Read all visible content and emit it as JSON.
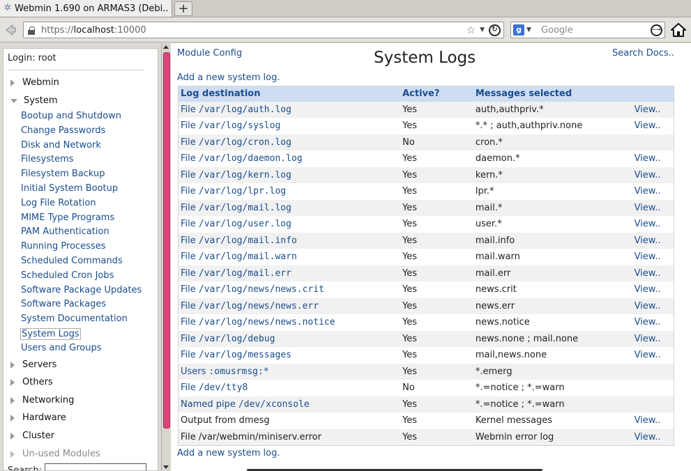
{
  "browser": {
    "tab_title": "Webmin 1.690 on ARMAS3 (Debi...",
    "new_tab_label": "+",
    "url_scheme": "https://",
    "url_host": "localhost",
    "url_port": ":10000",
    "search_engine_letter": "g",
    "search_placeholder": "Google"
  },
  "sidebar": {
    "login": "Login: root",
    "categories_top": [
      {
        "label": "Webmin"
      },
      {
        "label": "System"
      }
    ],
    "modules": [
      "Bootup and Shutdown",
      "Change Passwords",
      "Disk and Network",
      "Filesystems",
      "Filesystem Backup",
      "Initial System Bootup",
      "Log File Rotation",
      "MIME Type Programs",
      "PAM Authentication",
      "Running Processes",
      "Scheduled Commands",
      "Scheduled Cron Jobs",
      "Software Package Updates",
      "Software Packages",
      "System Documentation",
      "System Logs",
      "Users and Groups"
    ],
    "active_module": "System Logs",
    "categories_bottom": [
      "Servers",
      "Others",
      "Networking",
      "Hardware",
      "Cluster",
      "Un-used Modules"
    ],
    "search_label": "Search:"
  },
  "main": {
    "module_config": "Module Config",
    "title": "System Logs",
    "search_docs": "Search Docs..",
    "add_link": "Add a new system log.",
    "columns": [
      "Log destination",
      "Active?",
      "Messages selected",
      ""
    ],
    "rows": [
      {
        "prefix": "File ",
        "path": "/var/log/auth.log",
        "active": "Yes",
        "messages": "auth,authpriv.*",
        "view": "View.."
      },
      {
        "prefix": "File ",
        "path": "/var/log/syslog",
        "active": "Yes",
        "messages": "*.* ; auth,authpriv.none",
        "view": "View.."
      },
      {
        "prefix": "File ",
        "path": "/var/log/cron.log",
        "active": "No",
        "messages": "cron.*",
        "view": ""
      },
      {
        "prefix": "File ",
        "path": "/var/log/daemon.log",
        "active": "Yes",
        "messages": "daemon.*",
        "view": "View.."
      },
      {
        "prefix": "File ",
        "path": "/var/log/kern.log",
        "active": "Yes",
        "messages": "kern.*",
        "view": "View.."
      },
      {
        "prefix": "File ",
        "path": "/var/log/lpr.log",
        "active": "Yes",
        "messages": "lpr.*",
        "view": "View.."
      },
      {
        "prefix": "File ",
        "path": "/var/log/mail.log",
        "active": "Yes",
        "messages": "mail.*",
        "view": "View.."
      },
      {
        "prefix": "File ",
        "path": "/var/log/user.log",
        "active": "Yes",
        "messages": "user.*",
        "view": "View.."
      },
      {
        "prefix": "File ",
        "path": "/var/log/mail.info",
        "active": "Yes",
        "messages": "mail.info",
        "view": "View.."
      },
      {
        "prefix": "File ",
        "path": "/var/log/mail.warn",
        "active": "Yes",
        "messages": "mail.warn",
        "view": "View.."
      },
      {
        "prefix": "File ",
        "path": "/var/log/mail.err",
        "active": "Yes",
        "messages": "mail.err",
        "view": "View.."
      },
      {
        "prefix": "File ",
        "path": "/var/log/news/news.crit",
        "active": "Yes",
        "messages": "news.crit",
        "view": "View.."
      },
      {
        "prefix": "File ",
        "path": "/var/log/news/news.err",
        "active": "Yes",
        "messages": "news.err",
        "view": "View.."
      },
      {
        "prefix": "File ",
        "path": "/var/log/news/news.notice",
        "active": "Yes",
        "messages": "news.notice",
        "view": "View.."
      },
      {
        "prefix": "File ",
        "path": "/var/log/debug",
        "active": "Yes",
        "messages": "news.none ; mail.none",
        "view": "View.."
      },
      {
        "prefix": "File ",
        "path": "/var/log/messages",
        "active": "Yes",
        "messages": "mail,news.none",
        "view": "View.."
      },
      {
        "prefix": "Users ",
        "path": ":omusrmsg:*",
        "active": "Yes",
        "messages": "*.emerg",
        "view": ""
      },
      {
        "prefix": "File ",
        "path": "/dev/tty8",
        "active": "No",
        "messages": "*.=notice ; *.=warn",
        "view": ""
      },
      {
        "prefix": "Named pipe ",
        "path": "/dev/xconsole",
        "active": "Yes",
        "messages": "*.=notice ; *.=warn",
        "view": ""
      },
      {
        "prefix": "Output from dmesg",
        "path": "",
        "active": "Yes",
        "messages": "Kernel messages",
        "view": "View..",
        "plain": true
      },
      {
        "prefix": "File /var/webmin/miniserv.error",
        "path": "",
        "active": "Yes",
        "messages": "Webmin error log",
        "view": "View..",
        "plain": true
      }
    ]
  },
  "colors": {
    "link": "#1a4d8c",
    "header_bg": "#cfddf4",
    "inactive": "#d40000",
    "scroll_thumb": "#d9457a"
  }
}
